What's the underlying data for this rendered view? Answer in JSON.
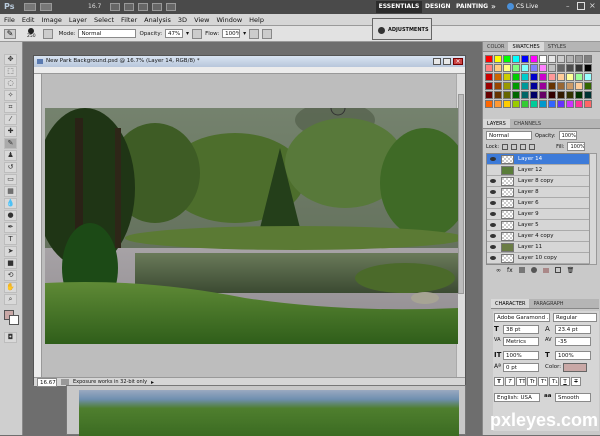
{
  "app_bar": {
    "logo": "Ps",
    "zoom": "16.7",
    "workspaces": [
      "ESSENTIALS",
      "DESIGN",
      "PAINTING"
    ],
    "more": "»",
    "cs_live": "CS Live"
  },
  "menu": [
    "File",
    "Edit",
    "Image",
    "Layer",
    "Select",
    "Filter",
    "Analysis",
    "3D",
    "View",
    "Window",
    "Help"
  ],
  "options": {
    "brush_size": "250",
    "mode_label": "Mode:",
    "mode_value": "Normal",
    "opacity_label": "Opacity:",
    "opacity_value": "47%",
    "flow_label": "Flow:",
    "flow_value": "100%"
  },
  "adjustments_label": "ADJUSTMENTS",
  "document": {
    "title": "New Park Background.psd @ 16.7% (Layer 14, RGB/8) *",
    "zoom": "16.67%",
    "status": "Exposure works in 32-bit only"
  },
  "swatch_tabs": [
    "COLOR",
    "SWATCHES",
    "STYLES"
  ],
  "swatch_colors": [
    "#ff0000",
    "#ffff00",
    "#00ff00",
    "#00ffff",
    "#0000ff",
    "#ff00ff",
    "#ffffff",
    "#e6e6e6",
    "#cccccc",
    "#b3b3b3",
    "#999999",
    "#808080",
    "#ff8080",
    "#ffcc80",
    "#ffff80",
    "#80ff80",
    "#80ffff",
    "#8080ff",
    "#ff80ff",
    "#c0c0c0",
    "#666666",
    "#4d4d4d",
    "#333333",
    "#000000",
    "#cc0000",
    "#cc6600",
    "#cccc00",
    "#00cc00",
    "#00cccc",
    "#0000cc",
    "#cc00cc",
    "#ff9999",
    "#ffcc99",
    "#ffff99",
    "#99ff99",
    "#99ffff",
    "#990000",
    "#994400",
    "#999900",
    "#009900",
    "#009999",
    "#000099",
    "#990099",
    "#663300",
    "#996633",
    "#cc9966",
    "#ffcc99",
    "#336600",
    "#660000",
    "#663300",
    "#666600",
    "#006600",
    "#006666",
    "#000066",
    "#660066",
    "#330000",
    "#331a00",
    "#333300",
    "#003300",
    "#003333",
    "#ff6600",
    "#ff9933",
    "#ffcc00",
    "#99cc00",
    "#33cc33",
    "#00cc99",
    "#0099cc",
    "#3366ff",
    "#6633ff",
    "#cc33ff",
    "#ff3399",
    "#ff6666"
  ],
  "layers_panel": {
    "tabs": [
      "LAYERS",
      "CHANNELS"
    ],
    "blend_mode": "Normal",
    "opacity_label": "Opacity:",
    "opacity_value": "100%",
    "lock_label": "Lock:",
    "fill_label": "Fill:",
    "fill_value": "100%",
    "layers": [
      "Layer 14",
      "Layer 12",
      "Layer 8 copy",
      "Layer 8",
      "Layer 6",
      "Layer 9",
      "Layer 5",
      "Layer 4 copy",
      "Layer 11",
      "Layer 10 copy"
    ]
  },
  "character_panel": {
    "tabs": [
      "CHARACTER",
      "PARAGRAPH"
    ],
    "font_family": "Adobe Garamond ...",
    "font_style": "Regular",
    "font_size": "38 pt",
    "leading": "23.4 pt",
    "kerning": "Metrics",
    "tracking": "-35",
    "vertical_scale": "100%",
    "horizontal_scale": "100%",
    "baseline": "0 pt",
    "color_label": "Color:",
    "style_buttons": [
      "T",
      "T",
      "TT",
      "Tr",
      "T¹",
      "T₁",
      "T",
      "T"
    ],
    "language": "English: USA",
    "antialias_icon": "aa",
    "antialias": "Smooth"
  },
  "watermark": "pxleyes.com"
}
